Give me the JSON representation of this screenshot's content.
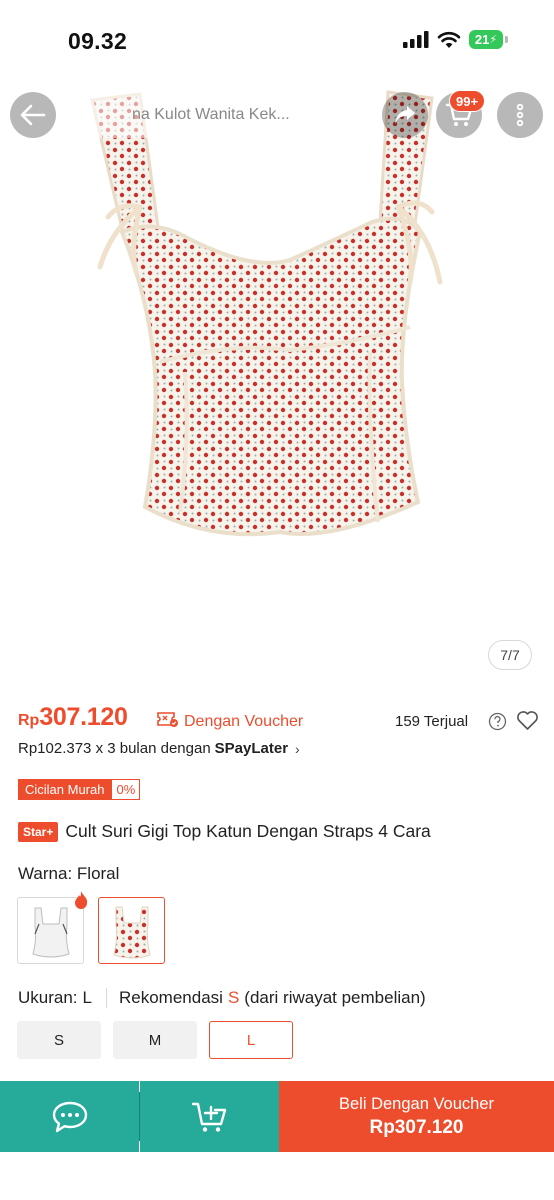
{
  "status_bar": {
    "time": "09.32",
    "battery": "21"
  },
  "header": {
    "search_text": "na Kulot Wanita Kek...",
    "cart_badge": "99+"
  },
  "gallery": {
    "counter": "7/7"
  },
  "price": {
    "currency": "Rp",
    "amount": "307.120",
    "voucher_label": "Dengan Voucher",
    "sold": "159 Terjual"
  },
  "paylater": {
    "text": "Rp102.373 x 3 bulan dengan",
    "brand": "SPayLater",
    "chevron": "›"
  },
  "installment": {
    "label": "Cicilan Murah",
    "percent": "0%"
  },
  "product": {
    "badge": "Star+",
    "title": "Cult Suri Gigi Top Katun Dengan Straps 4 Cara"
  },
  "variation": {
    "label": "Warna:",
    "value": "Floral"
  },
  "size": {
    "label": "Ukuran:",
    "value": "L",
    "recommend_prefix": "Rekomendasi",
    "recommend_size": "S",
    "recommend_suffix": "(dari riwayat pembelian)",
    "options": [
      "S",
      "M",
      "L"
    ]
  },
  "bottom_bar": {
    "buy_label": "Beli Dengan Voucher",
    "buy_price": "Rp307.120"
  },
  "colors": {
    "accent": "#ee4d2d",
    "teal": "#26aa99"
  }
}
